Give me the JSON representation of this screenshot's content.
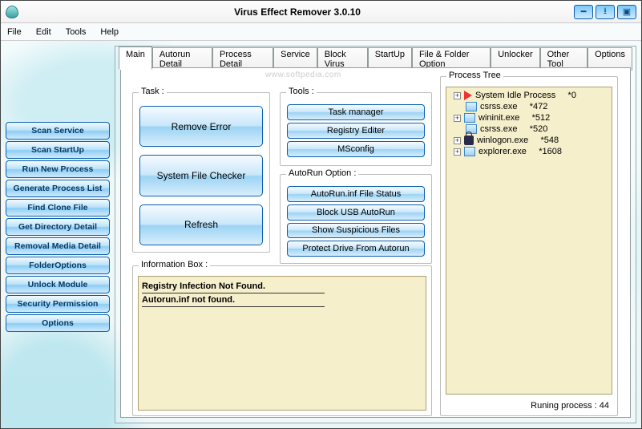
{
  "window": {
    "title": "Virus Effect Remover 3.0.10"
  },
  "menu": {
    "file": "File",
    "edit": "Edit",
    "tools": "Tools",
    "help": "Help"
  },
  "sidebar": {
    "items": [
      "Scan Service",
      "Scan StartUp",
      "Run New Process",
      "Generate Process List",
      "Find Clone File",
      "Get Directory Detail",
      "Removal Media Detail",
      "FolderOptions",
      "Unlock Module",
      "Security Permission",
      "Options"
    ]
  },
  "tabs": [
    "Main",
    "Autorun Detail",
    "Process Detail",
    "Service",
    "Block Virus",
    "StartUp",
    "File & Folder Option",
    "Unlocker",
    "Other Tool",
    "Options"
  ],
  "task": {
    "legend": "Task :",
    "buttons": {
      "remove": "Remove Error",
      "sfc": "System File Checker",
      "refresh": "Refresh"
    }
  },
  "tools": {
    "legend": "Tools :",
    "buttons": {
      "taskmgr": "Task manager",
      "regedit": "Registry Editer",
      "msconfig": "MSconfig"
    }
  },
  "autorun": {
    "legend": "AutoRun Option :",
    "buttons": {
      "status": "AutoRun.inf File Status",
      "block": "Block USB AutoRun",
      "show": "Show Suspicious Files",
      "protect": "Protect Drive From Autorun"
    }
  },
  "info": {
    "legend": "Information Box :",
    "lines": [
      "Registry Infection Not Found.",
      "Autorun.inf not found."
    ]
  },
  "tree": {
    "legend": "Process Tree",
    "items": [
      {
        "icon": "arrow",
        "name": "System Idle Process",
        "pid": "*0",
        "exp": true
      },
      {
        "icon": "proc",
        "name": "csrss.exe",
        "pid": "*472",
        "exp": false
      },
      {
        "icon": "proc",
        "name": "wininit.exe",
        "pid": "*512",
        "exp": true
      },
      {
        "icon": "proc",
        "name": "csrss.exe",
        "pid": "*520",
        "exp": false
      },
      {
        "icon": "lock",
        "name": "winlogon.exe",
        "pid": "*548",
        "exp": true
      },
      {
        "icon": "proc",
        "name": "explorer.exe",
        "pid": "*1608",
        "exp": true
      }
    ],
    "status": "Runing process : 44"
  },
  "watermark": "www.softpedia.com"
}
